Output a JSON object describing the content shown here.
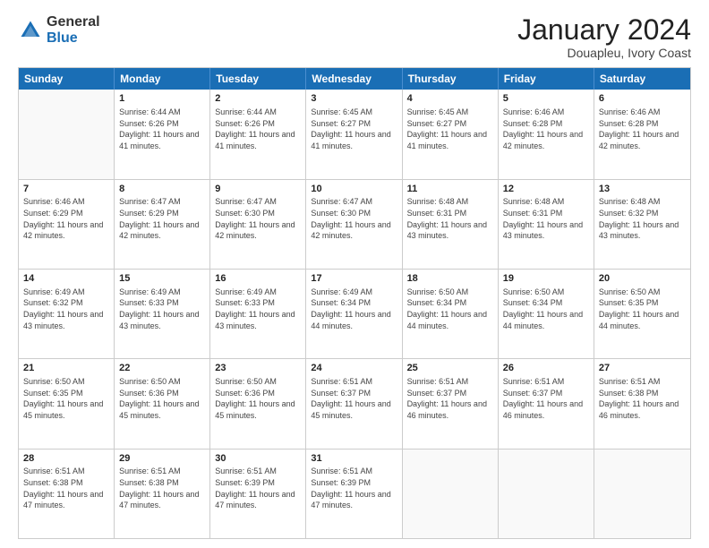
{
  "header": {
    "logo_line1": "General",
    "logo_line2": "Blue",
    "month_title": "January 2024",
    "location": "Douapleu, Ivory Coast"
  },
  "days_of_week": [
    "Sunday",
    "Monday",
    "Tuesday",
    "Wednesday",
    "Thursday",
    "Friday",
    "Saturday"
  ],
  "weeks": [
    [
      {
        "day": "",
        "sunrise": "",
        "sunset": "",
        "daylight": ""
      },
      {
        "day": "1",
        "sunrise": "Sunrise: 6:44 AM",
        "sunset": "Sunset: 6:26 PM",
        "daylight": "Daylight: 11 hours and 41 minutes."
      },
      {
        "day": "2",
        "sunrise": "Sunrise: 6:44 AM",
        "sunset": "Sunset: 6:26 PM",
        "daylight": "Daylight: 11 hours and 41 minutes."
      },
      {
        "day": "3",
        "sunrise": "Sunrise: 6:45 AM",
        "sunset": "Sunset: 6:27 PM",
        "daylight": "Daylight: 11 hours and 41 minutes."
      },
      {
        "day": "4",
        "sunrise": "Sunrise: 6:45 AM",
        "sunset": "Sunset: 6:27 PM",
        "daylight": "Daylight: 11 hours and 41 minutes."
      },
      {
        "day": "5",
        "sunrise": "Sunrise: 6:46 AM",
        "sunset": "Sunset: 6:28 PM",
        "daylight": "Daylight: 11 hours and 42 minutes."
      },
      {
        "day": "6",
        "sunrise": "Sunrise: 6:46 AM",
        "sunset": "Sunset: 6:28 PM",
        "daylight": "Daylight: 11 hours and 42 minutes."
      }
    ],
    [
      {
        "day": "7",
        "sunrise": "Sunrise: 6:46 AM",
        "sunset": "Sunset: 6:29 PM",
        "daylight": "Daylight: 11 hours and 42 minutes."
      },
      {
        "day": "8",
        "sunrise": "Sunrise: 6:47 AM",
        "sunset": "Sunset: 6:29 PM",
        "daylight": "Daylight: 11 hours and 42 minutes."
      },
      {
        "day": "9",
        "sunrise": "Sunrise: 6:47 AM",
        "sunset": "Sunset: 6:30 PM",
        "daylight": "Daylight: 11 hours and 42 minutes."
      },
      {
        "day": "10",
        "sunrise": "Sunrise: 6:47 AM",
        "sunset": "Sunset: 6:30 PM",
        "daylight": "Daylight: 11 hours and 42 minutes."
      },
      {
        "day": "11",
        "sunrise": "Sunrise: 6:48 AM",
        "sunset": "Sunset: 6:31 PM",
        "daylight": "Daylight: 11 hours and 43 minutes."
      },
      {
        "day": "12",
        "sunrise": "Sunrise: 6:48 AM",
        "sunset": "Sunset: 6:31 PM",
        "daylight": "Daylight: 11 hours and 43 minutes."
      },
      {
        "day": "13",
        "sunrise": "Sunrise: 6:48 AM",
        "sunset": "Sunset: 6:32 PM",
        "daylight": "Daylight: 11 hours and 43 minutes."
      }
    ],
    [
      {
        "day": "14",
        "sunrise": "Sunrise: 6:49 AM",
        "sunset": "Sunset: 6:32 PM",
        "daylight": "Daylight: 11 hours and 43 minutes."
      },
      {
        "day": "15",
        "sunrise": "Sunrise: 6:49 AM",
        "sunset": "Sunset: 6:33 PM",
        "daylight": "Daylight: 11 hours and 43 minutes."
      },
      {
        "day": "16",
        "sunrise": "Sunrise: 6:49 AM",
        "sunset": "Sunset: 6:33 PM",
        "daylight": "Daylight: 11 hours and 43 minutes."
      },
      {
        "day": "17",
        "sunrise": "Sunrise: 6:49 AM",
        "sunset": "Sunset: 6:34 PM",
        "daylight": "Daylight: 11 hours and 44 minutes."
      },
      {
        "day": "18",
        "sunrise": "Sunrise: 6:50 AM",
        "sunset": "Sunset: 6:34 PM",
        "daylight": "Daylight: 11 hours and 44 minutes."
      },
      {
        "day": "19",
        "sunrise": "Sunrise: 6:50 AM",
        "sunset": "Sunset: 6:34 PM",
        "daylight": "Daylight: 11 hours and 44 minutes."
      },
      {
        "day": "20",
        "sunrise": "Sunrise: 6:50 AM",
        "sunset": "Sunset: 6:35 PM",
        "daylight": "Daylight: 11 hours and 44 minutes."
      }
    ],
    [
      {
        "day": "21",
        "sunrise": "Sunrise: 6:50 AM",
        "sunset": "Sunset: 6:35 PM",
        "daylight": "Daylight: 11 hours and 45 minutes."
      },
      {
        "day": "22",
        "sunrise": "Sunrise: 6:50 AM",
        "sunset": "Sunset: 6:36 PM",
        "daylight": "Daylight: 11 hours and 45 minutes."
      },
      {
        "day": "23",
        "sunrise": "Sunrise: 6:50 AM",
        "sunset": "Sunset: 6:36 PM",
        "daylight": "Daylight: 11 hours and 45 minutes."
      },
      {
        "day": "24",
        "sunrise": "Sunrise: 6:51 AM",
        "sunset": "Sunset: 6:37 PM",
        "daylight": "Daylight: 11 hours and 45 minutes."
      },
      {
        "day": "25",
        "sunrise": "Sunrise: 6:51 AM",
        "sunset": "Sunset: 6:37 PM",
        "daylight": "Daylight: 11 hours and 46 minutes."
      },
      {
        "day": "26",
        "sunrise": "Sunrise: 6:51 AM",
        "sunset": "Sunset: 6:37 PM",
        "daylight": "Daylight: 11 hours and 46 minutes."
      },
      {
        "day": "27",
        "sunrise": "Sunrise: 6:51 AM",
        "sunset": "Sunset: 6:38 PM",
        "daylight": "Daylight: 11 hours and 46 minutes."
      }
    ],
    [
      {
        "day": "28",
        "sunrise": "Sunrise: 6:51 AM",
        "sunset": "Sunset: 6:38 PM",
        "daylight": "Daylight: 11 hours and 47 minutes."
      },
      {
        "day": "29",
        "sunrise": "Sunrise: 6:51 AM",
        "sunset": "Sunset: 6:38 PM",
        "daylight": "Daylight: 11 hours and 47 minutes."
      },
      {
        "day": "30",
        "sunrise": "Sunrise: 6:51 AM",
        "sunset": "Sunset: 6:39 PM",
        "daylight": "Daylight: 11 hours and 47 minutes."
      },
      {
        "day": "31",
        "sunrise": "Sunrise: 6:51 AM",
        "sunset": "Sunset: 6:39 PM",
        "daylight": "Daylight: 11 hours and 47 minutes."
      },
      {
        "day": "",
        "sunrise": "",
        "sunset": "",
        "daylight": ""
      },
      {
        "day": "",
        "sunrise": "",
        "sunset": "",
        "daylight": ""
      },
      {
        "day": "",
        "sunrise": "",
        "sunset": "",
        "daylight": ""
      }
    ]
  ]
}
